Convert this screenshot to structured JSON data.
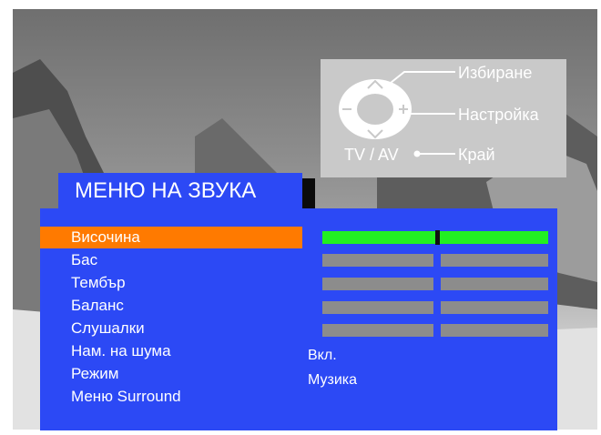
{
  "hint": {
    "select_label": "Избиране",
    "adjust_label": "Настройка",
    "tvav_label": "TV / AV",
    "exit_label": "Край"
  },
  "menu": {
    "title": "МЕНЮ НА ЗВУКА",
    "items": [
      {
        "label": "Височина"
      },
      {
        "label": "Бас"
      },
      {
        "label": "Тембър"
      },
      {
        "label": "Баланс"
      },
      {
        "label": "Слушалки"
      },
      {
        "label": "Нам. на шума"
      },
      {
        "label": "Режим"
      },
      {
        "label": "Меню Surround"
      }
    ],
    "selected_index": 0,
    "noise_value": "Вкл.",
    "mode_value": "Музика"
  },
  "sliders": {
    "volume_level": 0.5
  },
  "colors": {
    "menu_blue": "#2c49f5",
    "selection_orange": "#ff7a00",
    "active_bar_green": "#22ef22",
    "inactive_bar_gray": "#8c8c8c"
  }
}
